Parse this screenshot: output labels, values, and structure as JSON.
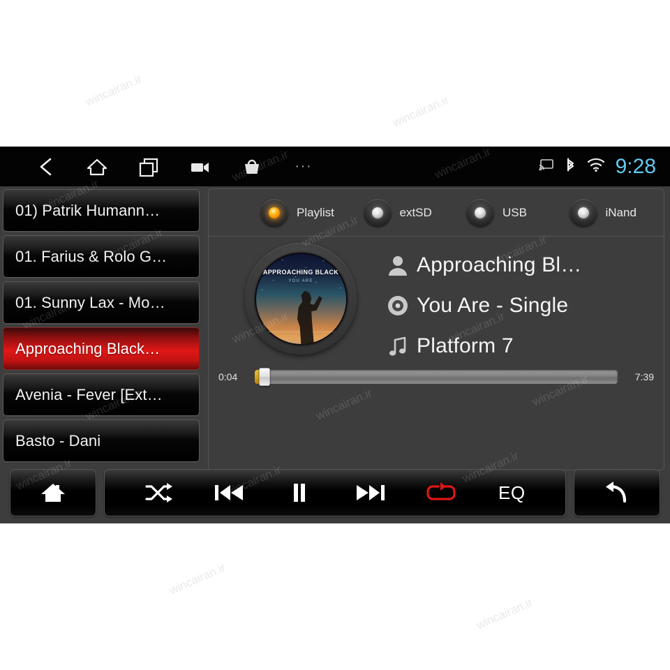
{
  "statusbar": {
    "nav": [
      {
        "name": "back-icon",
        "label": "back"
      },
      {
        "name": "home-icon",
        "label": "home"
      },
      {
        "name": "recent-apps-icon",
        "label": "recent apps"
      },
      {
        "name": "camera-icon",
        "label": "camera"
      },
      {
        "name": "shopping-bag-icon",
        "label": "apps"
      },
      {
        "name": "more-icon",
        "label": "more"
      }
    ],
    "more_glyph": "···",
    "cast_icon": "cast-icon",
    "bluetooth_icon": "bluetooth-icon",
    "wifi_icon": "wifi-icon",
    "time": "9:28",
    "time_color": "#64c8f0"
  },
  "playlist": {
    "items": [
      {
        "label": "01) Patrik Humann…",
        "selected": false
      },
      {
        "label": "01. Farius & Rolo G…",
        "selected": false
      },
      {
        "label": "01. Sunny Lax - Mo…",
        "selected": false
      },
      {
        "label": "Approaching Black…",
        "selected": true
      },
      {
        "label": "Avenia - Fever [Ext…",
        "selected": false
      },
      {
        "label": "Basto - Dani",
        "selected": false
      }
    ],
    "selected_color": "#e01717"
  },
  "sources": {
    "options": [
      {
        "label": "Playlist",
        "active": true
      },
      {
        "label": "extSD",
        "active": false
      },
      {
        "label": "USB",
        "active": false
      },
      {
        "label": "iNand",
        "active": false
      }
    ],
    "active_led_color": "#ffb11a"
  },
  "album_art": {
    "title": "APPROACHING BLACK",
    "subtitle": "YOU ARE"
  },
  "track": {
    "rows": [
      {
        "icon": "artist-icon",
        "text": "Approaching Bl…"
      },
      {
        "icon": "album-disc-icon",
        "text": "You Are - Single"
      },
      {
        "icon": "music-note-icon",
        "text": "Platform 7"
      }
    ]
  },
  "progress": {
    "elapsed": "0:04",
    "duration": "7:39",
    "percent": 1
  },
  "controls": {
    "home_label": "home",
    "shuffle_label": "shuffle",
    "previous_label": "previous",
    "pause_label": "pause",
    "next_label": "next",
    "repeat_label": "repeat",
    "repeat_active": true,
    "repeat_color": "#e01515",
    "eq_label": "EQ",
    "back_label": "back"
  },
  "watermark": {
    "text": "wincairan.ir"
  }
}
